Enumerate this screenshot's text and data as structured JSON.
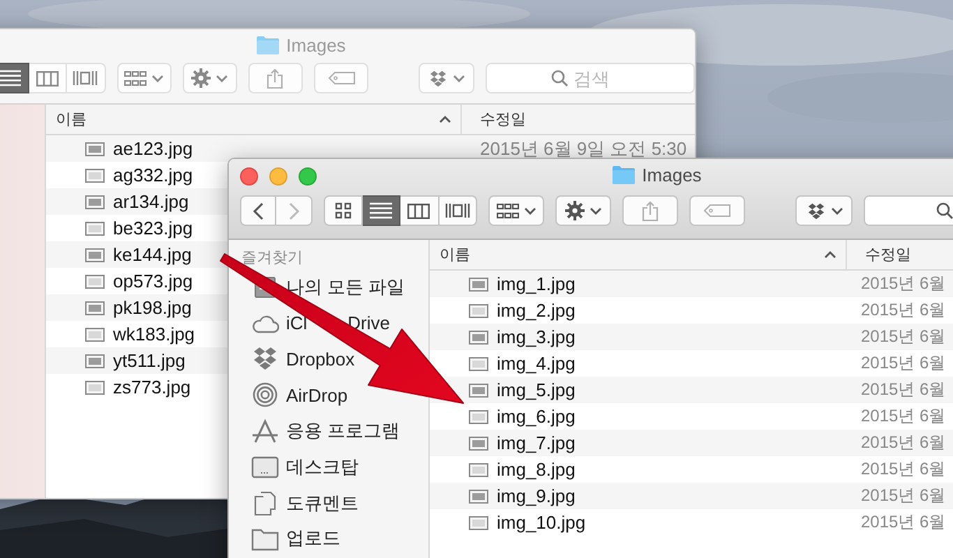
{
  "back_window": {
    "title": "Images",
    "view_modes": [
      {
        "kind": "list",
        "selected": true
      },
      {
        "kind": "columns",
        "selected": false
      },
      {
        "kind": "coverflow",
        "selected": false
      }
    ],
    "search": {
      "placeholder": "검색"
    },
    "columns": [
      "이름",
      "수정일"
    ],
    "rows": [
      {
        "name": "ae123.jpg",
        "modified": "2015년 6월 9일 오전 5:30"
      },
      {
        "name": "ag332.jpg"
      },
      {
        "name": "ar134.jpg"
      },
      {
        "name": "be323.jpg"
      },
      {
        "name": "ke144.jpg"
      },
      {
        "name": "op573.jpg"
      },
      {
        "name": "pk198.jpg"
      },
      {
        "name": "wk183.jpg"
      },
      {
        "name": "yt511.jpg"
      },
      {
        "name": "zs773.jpg"
      }
    ]
  },
  "front_window": {
    "title": "Images",
    "view_modes": [
      {
        "kind": "icons",
        "selected": false
      },
      {
        "kind": "list",
        "selected": true
      },
      {
        "kind": "columns",
        "selected": false
      },
      {
        "kind": "coverflow",
        "selected": false
      }
    ],
    "sidebar": {
      "heading": "즐겨찾기",
      "items": [
        {
          "kind": "allfiles",
          "label": "나의 모든 파일"
        },
        {
          "kind": "cloud",
          "parts": [
            "iCl",
            "Drive"
          ]
        },
        {
          "kind": "dropbox",
          "label": "Dropbox"
        },
        {
          "kind": "airdrop",
          "label": "AirDrop"
        },
        {
          "kind": "apps",
          "label": "응용 프로그램"
        },
        {
          "kind": "desktop",
          "label": "데스크탑"
        },
        {
          "kind": "documents",
          "label": "도큐멘트"
        },
        {
          "kind": "folder",
          "label": "업로드"
        }
      ]
    },
    "columns": [
      "이름",
      "수정일"
    ],
    "rows": [
      {
        "name": "img_1.jpg",
        "modified": "2015년 6월"
      },
      {
        "name": "img_2.jpg",
        "modified": "2015년 6월"
      },
      {
        "name": "img_3.jpg",
        "modified": "2015년 6월"
      },
      {
        "name": "img_4.jpg",
        "modified": "2015년 6월"
      },
      {
        "name": "img_5.jpg",
        "modified": "2015년 6월"
      },
      {
        "name": "img_6.jpg",
        "modified": "2015년 6월"
      },
      {
        "name": "img_7.jpg",
        "modified": "2015년 6월"
      },
      {
        "name": "img_8.jpg",
        "modified": "2015년 6월"
      },
      {
        "name": "img_9.jpg",
        "modified": "2015년 6월"
      },
      {
        "name": "img_10.jpg",
        "modified": "2015년 6월"
      }
    ]
  }
}
